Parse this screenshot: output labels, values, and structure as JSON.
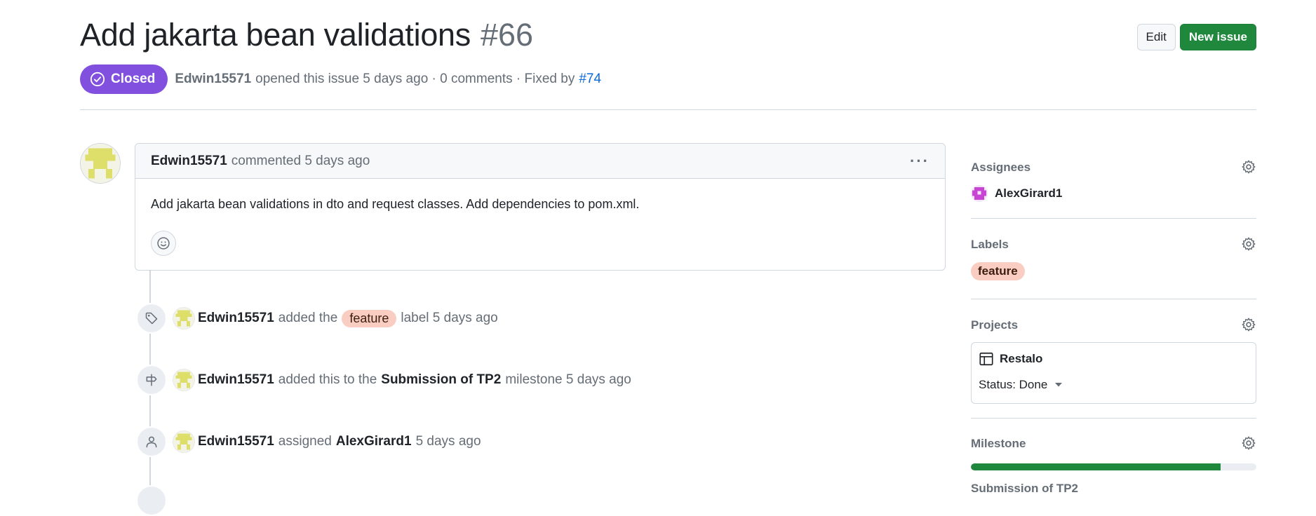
{
  "issue": {
    "title": "Add jakarta bean validations",
    "number": "#66",
    "state": "Closed",
    "author": "Edwin15571",
    "opened_text": "opened this issue 5 days ago · 0 comments · Fixed by",
    "fixed_by": "#74"
  },
  "header": {
    "edit_label": "Edit",
    "new_issue_label": "New issue"
  },
  "comment": {
    "author": "Edwin15571",
    "meta": "commented 5 days ago",
    "body": "Add jakarta bean validations in dto and request classes. Add dependencies to pom.xml."
  },
  "timeline": {
    "label_event": {
      "author": "Edwin15571",
      "pre": "added the",
      "label": "feature",
      "post": "label 5 days ago"
    },
    "milestone_event": {
      "author": "Edwin15571",
      "pre": "added this to the",
      "milestone": "Submission of TP2",
      "post": "milestone 5 days ago"
    },
    "assign_event": {
      "author": "Edwin15571",
      "pre": "assigned",
      "assignee": "AlexGirard1",
      "post": "5 days ago"
    }
  },
  "sidebar": {
    "assignees_title": "Assignees",
    "assignee": "AlexGirard1",
    "labels_title": "Labels",
    "label": "feature",
    "projects_title": "Projects",
    "project_name": "Restalo",
    "project_status": "Status: Done",
    "milestone_title": "Milestone",
    "milestone_name": "Submission of TP2",
    "milestone_progress": 0.875
  },
  "colors": {
    "closed_badge": "#8250df",
    "primary_button": "#1f883d",
    "label_feature": "#f9cdc1",
    "link": "#0969da"
  }
}
